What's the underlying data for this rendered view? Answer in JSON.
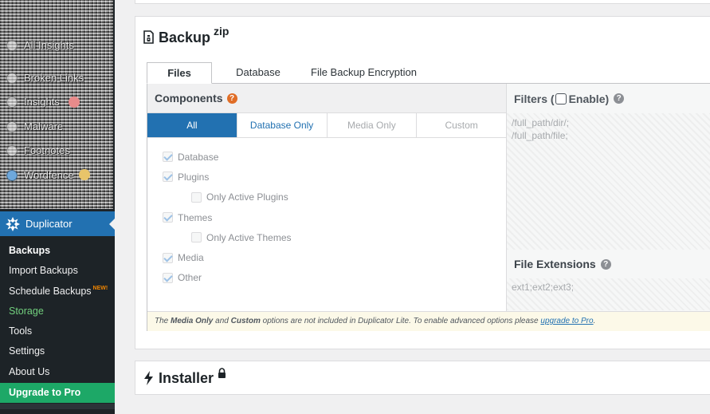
{
  "sidebar": {
    "obscured_items": [
      {
        "label": "All Insights",
        "icon": "chart-icon"
      },
      {
        "label": "Broken Links",
        "icon": "link-icon"
      },
      {
        "label": "Insights",
        "icon": "insights-icon"
      },
      {
        "label": "Malware",
        "icon": "shield-icon"
      },
      {
        "label": "Footnotes",
        "icon": "note-icon"
      },
      {
        "label": "Wordfence",
        "icon": "wordfence-icon"
      }
    ],
    "plugin": {
      "label": "Duplicator",
      "icon": "duplicator-icon"
    },
    "submenu": [
      {
        "label": "Backups",
        "state": "current"
      },
      {
        "label": "Import Backups"
      },
      {
        "label": "Schedule Backups",
        "badge": "NEW!"
      },
      {
        "label": "Storage",
        "state": "highlight"
      },
      {
        "label": "Tools"
      },
      {
        "label": "Settings"
      },
      {
        "label": "About Us"
      },
      {
        "label": "Upgrade to Pro",
        "state": "upgrade"
      }
    ]
  },
  "backup": {
    "title": "Backup",
    "title_sup": "zip",
    "icon": "file-zip-icon",
    "tabs": [
      {
        "label": "Files",
        "active": true
      },
      {
        "label": "Database"
      },
      {
        "label": "File Backup Encryption"
      }
    ],
    "components": {
      "header": "Components",
      "help": "?",
      "segments": [
        "All",
        "Database Only",
        "Media Only",
        "Custom"
      ],
      "selected_segment": "All",
      "checkboxes": [
        {
          "label": "Database",
          "checked": true,
          "indent": false
        },
        {
          "label": "Plugins",
          "checked": true,
          "indent": false
        },
        {
          "label": "Only Active Plugins",
          "checked": false,
          "indent": true
        },
        {
          "label": "Themes",
          "checked": true,
          "indent": false
        },
        {
          "label": "Only Active Themes",
          "checked": false,
          "indent": true
        },
        {
          "label": "Media",
          "checked": true,
          "indent": false
        },
        {
          "label": "Other",
          "checked": true,
          "indent": false
        }
      ]
    },
    "filters": {
      "header_prefix": "Filters (",
      "enable_label": "Enable)",
      "enabled": false,
      "help": "?",
      "paths_placeholder_lines": [
        "/full_path/dir/;",
        "/full_path/file;"
      ],
      "extensions_header": "File Extensions",
      "extensions_placeholder": "ext1;ext2;ext3;"
    },
    "notice": {
      "prefix": "The ",
      "media_only": "Media Only",
      "and": " and ",
      "custom": "Custom",
      "middle": " options are not included in Duplicator Lite. To enable advanced options please ",
      "link": "upgrade to Pro",
      "suffix": "."
    }
  },
  "installer": {
    "title": "Installer",
    "icon": "bolt-icon",
    "lock_icon": "lock-icon"
  },
  "colors": {
    "accent_blue": "#2271b1",
    "help_orange": "#e06d26",
    "upgrade_green": "#1da867",
    "storage_green": "#72d07e",
    "new_badge_orange": "#f18500",
    "admin_sidebar": "#1d2327"
  }
}
